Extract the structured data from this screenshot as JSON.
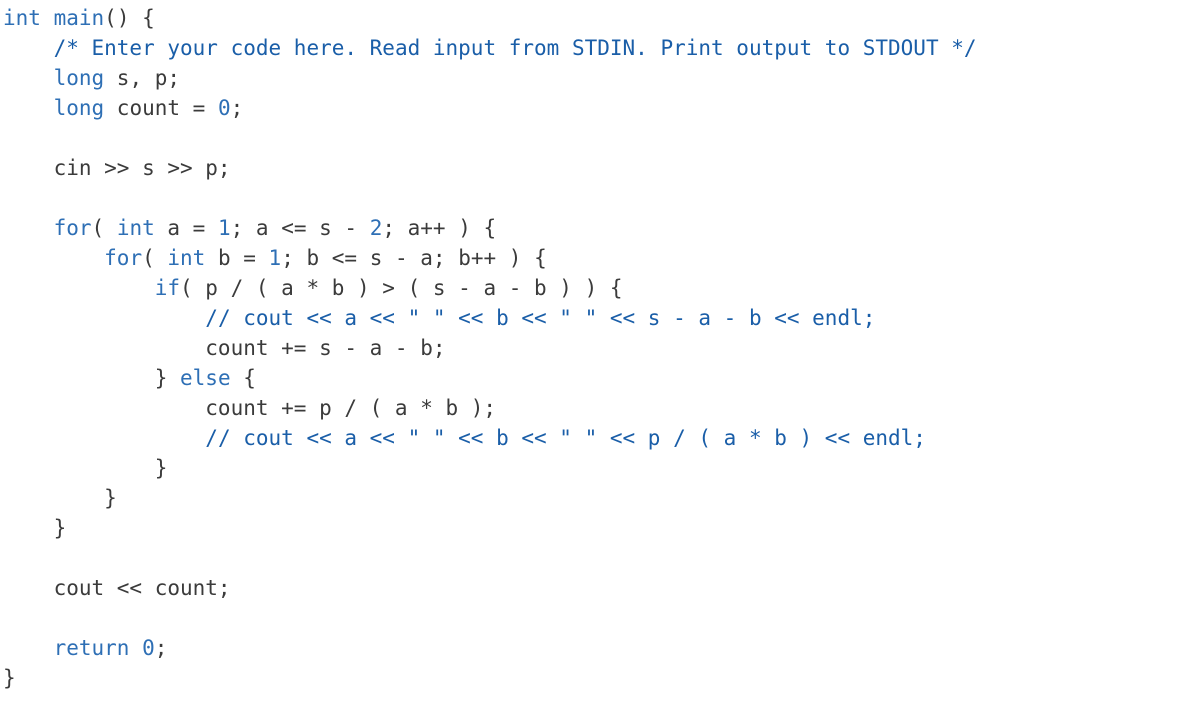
{
  "editor": {
    "colors": {
      "background": "#ffffff",
      "text": "#3b3b3b",
      "keyword": "#2e6fb5",
      "comment": "#1a5ea8"
    },
    "lines": [
      [
        {
          "t": "kw",
          "v": "int"
        },
        {
          "t": "plain",
          "v": " "
        },
        {
          "t": "kw",
          "v": "main"
        },
        {
          "t": "plain",
          "v": "() {"
        }
      ],
      [
        {
          "t": "plain",
          "v": "    "
        },
        {
          "t": "cm",
          "v": "/* Enter your code here. Read input from STDIN. Print output to STDOUT */"
        }
      ],
      [
        {
          "t": "plain",
          "v": "    "
        },
        {
          "t": "kw",
          "v": "long"
        },
        {
          "t": "plain",
          "v": " s, p;"
        }
      ],
      [
        {
          "t": "plain",
          "v": "    "
        },
        {
          "t": "kw",
          "v": "long"
        },
        {
          "t": "plain",
          "v": " count = "
        },
        {
          "t": "num",
          "v": "0"
        },
        {
          "t": "plain",
          "v": ";"
        }
      ],
      [
        {
          "t": "plain",
          "v": ""
        }
      ],
      [
        {
          "t": "plain",
          "v": "    cin >> s >> p;"
        }
      ],
      [
        {
          "t": "plain",
          "v": ""
        }
      ],
      [
        {
          "t": "plain",
          "v": "    "
        },
        {
          "t": "kw",
          "v": "for"
        },
        {
          "t": "plain",
          "v": "( "
        },
        {
          "t": "kw",
          "v": "int"
        },
        {
          "t": "plain",
          "v": " a = "
        },
        {
          "t": "num",
          "v": "1"
        },
        {
          "t": "plain",
          "v": "; a <= s - "
        },
        {
          "t": "num",
          "v": "2"
        },
        {
          "t": "plain",
          "v": "; a++ ) {"
        }
      ],
      [
        {
          "t": "plain",
          "v": "        "
        },
        {
          "t": "kw",
          "v": "for"
        },
        {
          "t": "plain",
          "v": "( "
        },
        {
          "t": "kw",
          "v": "int"
        },
        {
          "t": "plain",
          "v": " b = "
        },
        {
          "t": "num",
          "v": "1"
        },
        {
          "t": "plain",
          "v": "; b <= s - a; b++ ) {"
        }
      ],
      [
        {
          "t": "plain",
          "v": "            "
        },
        {
          "t": "kw",
          "v": "if"
        },
        {
          "t": "plain",
          "v": "( p / ( a * b ) > ( s - a - b ) ) {"
        }
      ],
      [
        {
          "t": "plain",
          "v": "                "
        },
        {
          "t": "cm",
          "v": "// cout << a << \" \" << b << \" \" << s - a - b << endl;"
        }
      ],
      [
        {
          "t": "plain",
          "v": "                count += s - a - b;"
        }
      ],
      [
        {
          "t": "plain",
          "v": "            } "
        },
        {
          "t": "kw",
          "v": "else"
        },
        {
          "t": "plain",
          "v": " {"
        }
      ],
      [
        {
          "t": "plain",
          "v": "                count += p / ( a * b );"
        }
      ],
      [
        {
          "t": "plain",
          "v": "                "
        },
        {
          "t": "cm",
          "v": "// cout << a << \" \" << b << \" \" << p / ( a * b ) << endl;"
        }
      ],
      [
        {
          "t": "plain",
          "v": "            }"
        }
      ],
      [
        {
          "t": "plain",
          "v": "        }"
        }
      ],
      [
        {
          "t": "plain",
          "v": "    }"
        }
      ],
      [
        {
          "t": "plain",
          "v": ""
        }
      ],
      [
        {
          "t": "plain",
          "v": "    cout << count;"
        }
      ],
      [
        {
          "t": "plain",
          "v": ""
        }
      ],
      [
        {
          "t": "plain",
          "v": "    "
        },
        {
          "t": "kw",
          "v": "return"
        },
        {
          "t": "plain",
          "v": " "
        },
        {
          "t": "num",
          "v": "0"
        },
        {
          "t": "plain",
          "v": ";"
        }
      ],
      [
        {
          "t": "plain",
          "v": "}"
        }
      ]
    ]
  }
}
